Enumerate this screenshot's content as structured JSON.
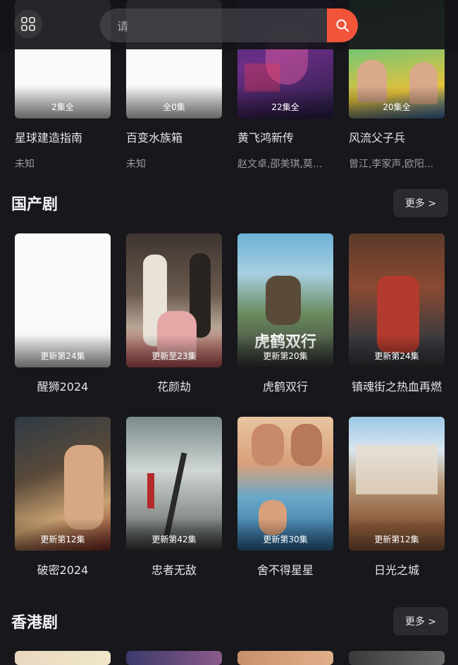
{
  "header": {
    "search_placeholder": "请"
  },
  "top_row": [
    {
      "ep": "2集全",
      "title": "星球建造指南",
      "cast": "未知"
    },
    {
      "ep": "全0集",
      "title": "百变水族箱",
      "cast": "未知"
    },
    {
      "ep": "22集全",
      "title": "黄飞鸿新传",
      "cast": "赵文卓,邵美琪,莫..."
    },
    {
      "ep": "20集全",
      "title": "风流父子兵",
      "cast": "曾江,李家声,欧阳..."
    }
  ],
  "section_domestic": {
    "title": "国产剧",
    "more": "更多 >",
    "row1": [
      {
        "ep": "更新第24集",
        "title": "醒狮2024"
      },
      {
        "ep": "更新至23集",
        "title": "花颜劫"
      },
      {
        "ep": "更新第20集",
        "title": "虎鹤双行",
        "poster_text": "虎鹤双行"
      },
      {
        "ep": "更新第24集",
        "title": "镇魂街之热血再燃"
      }
    ],
    "row2": [
      {
        "ep": "更新第12集",
        "title": "破密2024"
      },
      {
        "ep": "更新第42集",
        "title": "忠者无敌"
      },
      {
        "ep": "更新第30集",
        "title": "舍不得星星"
      },
      {
        "ep": "更新第12集",
        "title": "日光之城"
      }
    ]
  },
  "section_hk": {
    "title": "香港剧",
    "more": "更多 >"
  },
  "colors": {
    "accent": "#f2543a",
    "bg": "#17171c"
  }
}
